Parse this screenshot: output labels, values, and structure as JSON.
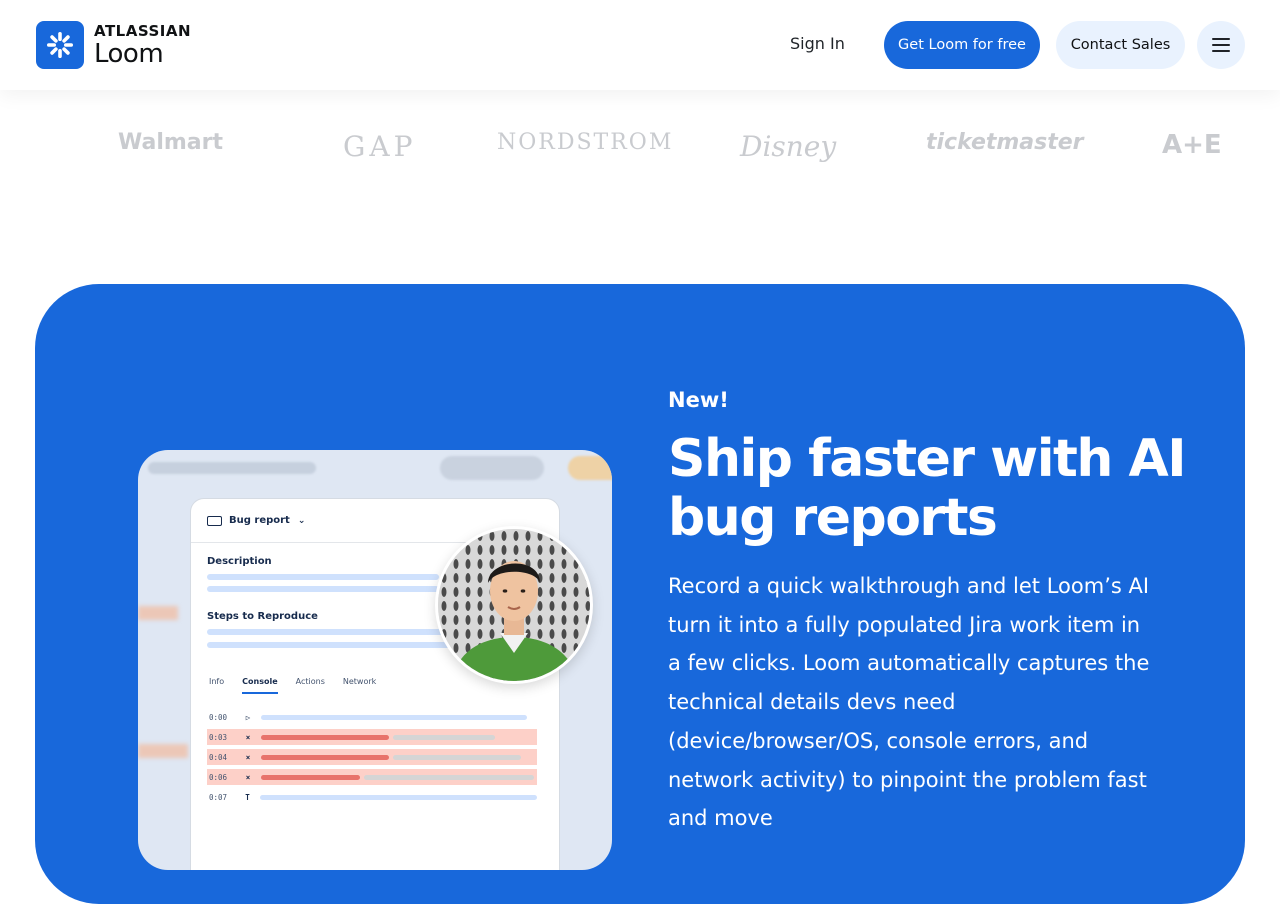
{
  "header": {
    "brand": "ATLASSIAN",
    "product": "Loom",
    "sign_in": "Sign In",
    "cta_primary": "Get Loom for free",
    "cta_secondary": "Contact Sales",
    "menu_icon": "hamburger-menu-icon"
  },
  "logos": [
    "Walmart",
    "GAP",
    "NORDSTROM",
    "Disney",
    "ticketmaster",
    "A+E"
  ],
  "mockup": {
    "title": "Bug report",
    "description_label": "Description",
    "steps_label": "Steps to Reproduce",
    "tabs": [
      "Info",
      "Console",
      "Actions",
      "Network"
    ],
    "active_tab": "Console",
    "log": [
      {
        "time": "0:00",
        "symbol": "▷",
        "type": "info"
      },
      {
        "time": "0:03",
        "symbol": "×",
        "type": "error"
      },
      {
        "time": "0:04",
        "symbol": "×",
        "type": "error"
      },
      {
        "time": "0:06",
        "symbol": "×",
        "type": "error"
      },
      {
        "time": "0:07",
        "symbol": "T",
        "type": "info"
      }
    ]
  },
  "feature": {
    "badge": "New!",
    "headline": "Ship faster with AI bug reports",
    "body": "Record a quick walkthrough and let Loom’s AI turn it into a fully populated Jira work item in a few clicks. Loom automatically captures the technical details devs need (device/browser/OS, console errors, and network activity) to pinpoint the problem fast and move"
  },
  "colors": {
    "brand_blue": "#1868db",
    "secondary_bg": "#e9f2fe",
    "error_row": "#fdd0c8"
  }
}
